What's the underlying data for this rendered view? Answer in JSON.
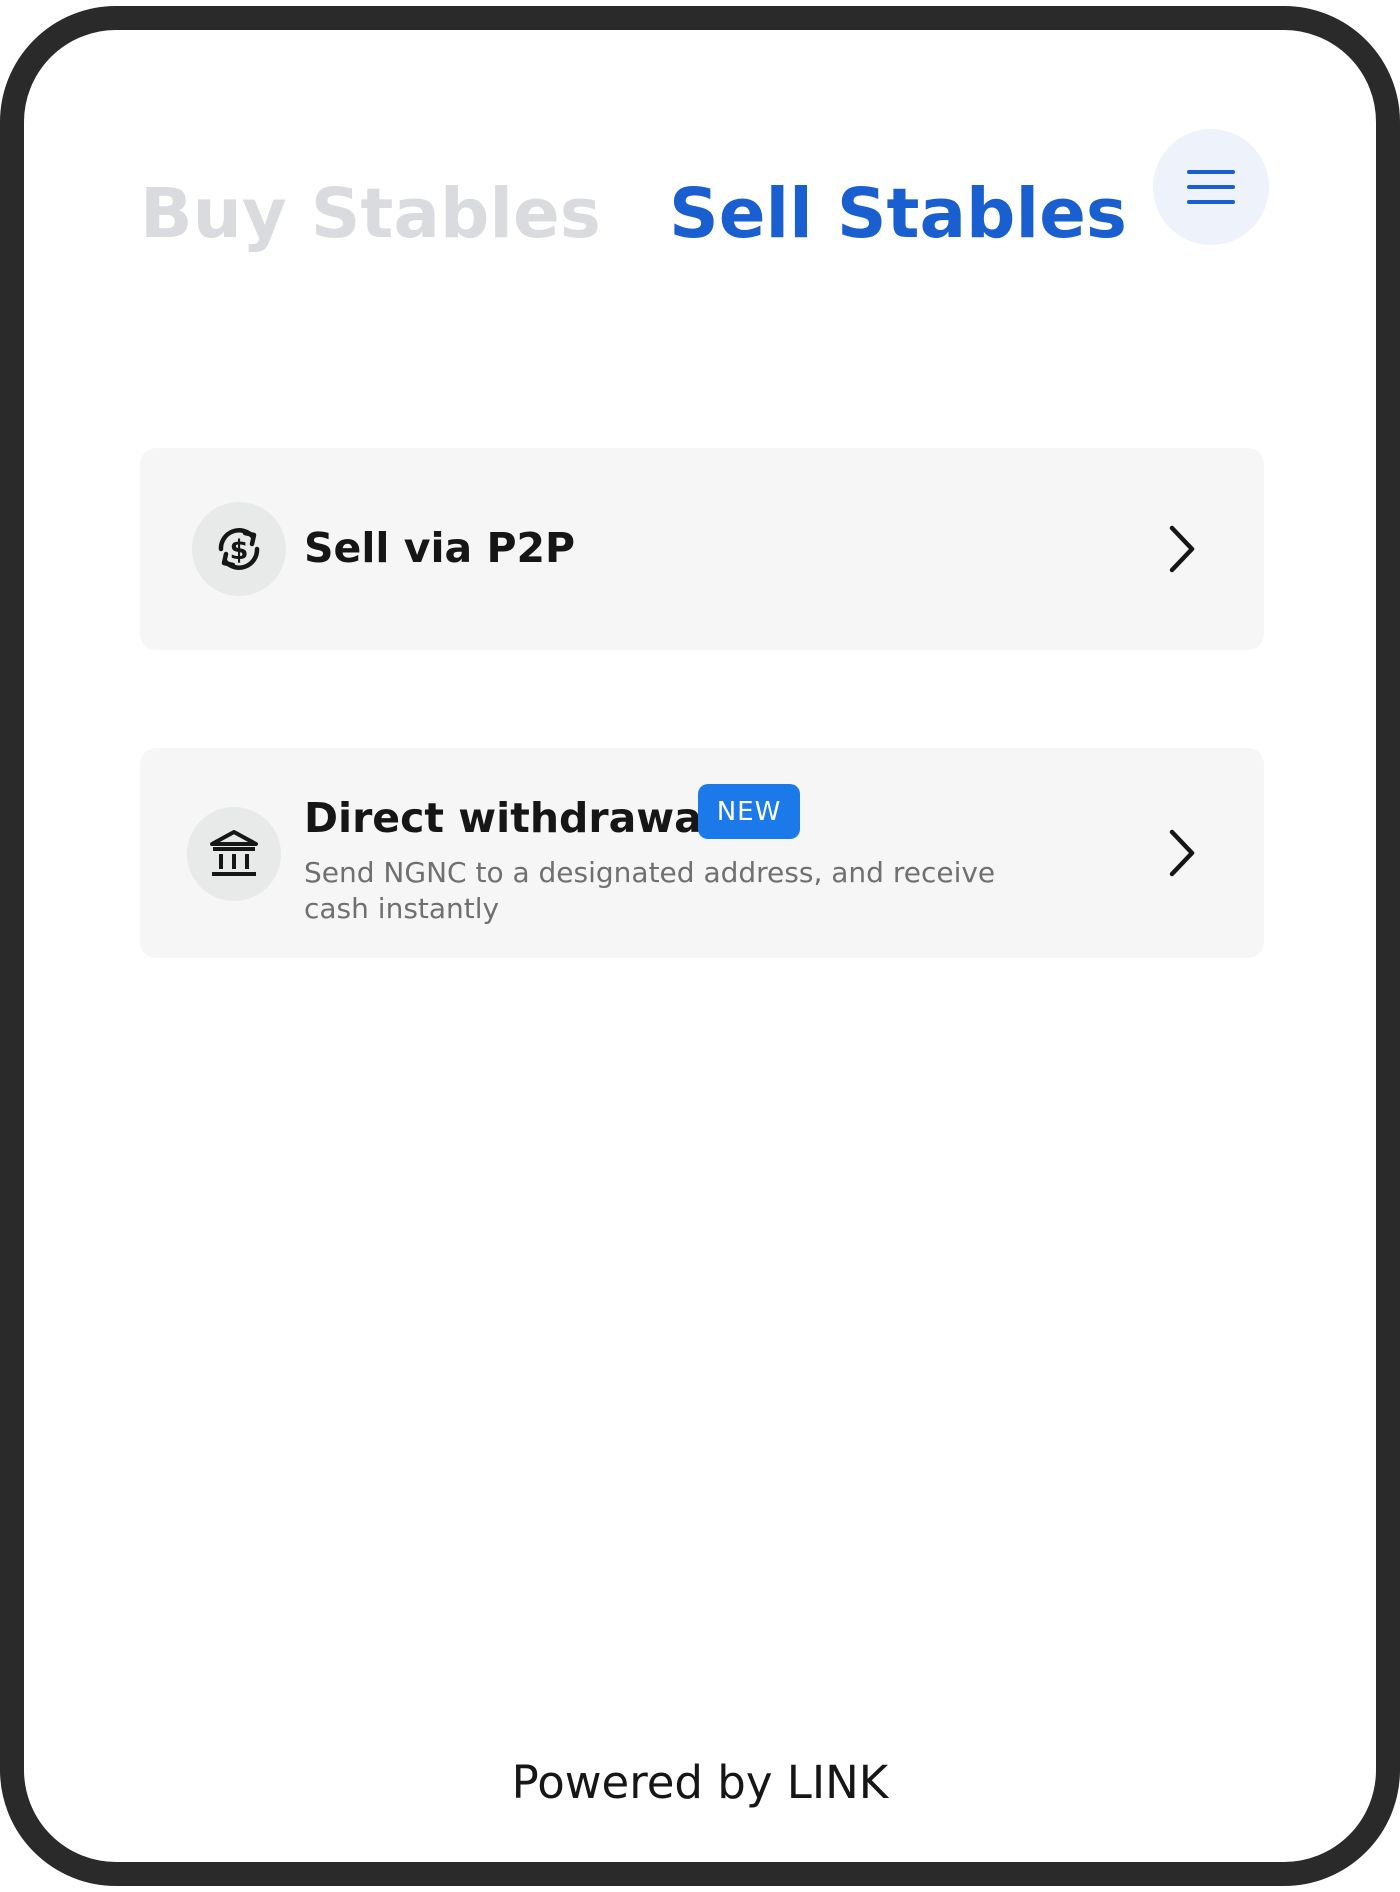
{
  "header": {
    "tabs": [
      {
        "label": "Buy Stables",
        "active": false
      },
      {
        "label": "Sell Stables",
        "active": true
      }
    ],
    "menu_icon": "hamburger-menu-icon"
  },
  "options": [
    {
      "title": "Sell via P2P",
      "icon": "currency-exchange-icon",
      "chevron": "chevron-right-icon"
    },
    {
      "title": "Direct withdrawal",
      "badge": "NEW",
      "description": "Send NGNC to a designated address, and receive cash instantly",
      "icon": "bank-icon",
      "chevron": "chevron-right-icon"
    }
  ],
  "footer": {
    "text": "Powered by LINK"
  },
  "colors": {
    "frame": "#2a2a2a",
    "active_tab": "#1a5fcf",
    "inactive_tab": "#dadbde",
    "menu_button_bg": "#eef3fb",
    "card_bg": "#f6f6f6",
    "badge_bg": "#1c79ea",
    "text_primary": "#161616",
    "text_secondary": "#707070"
  }
}
